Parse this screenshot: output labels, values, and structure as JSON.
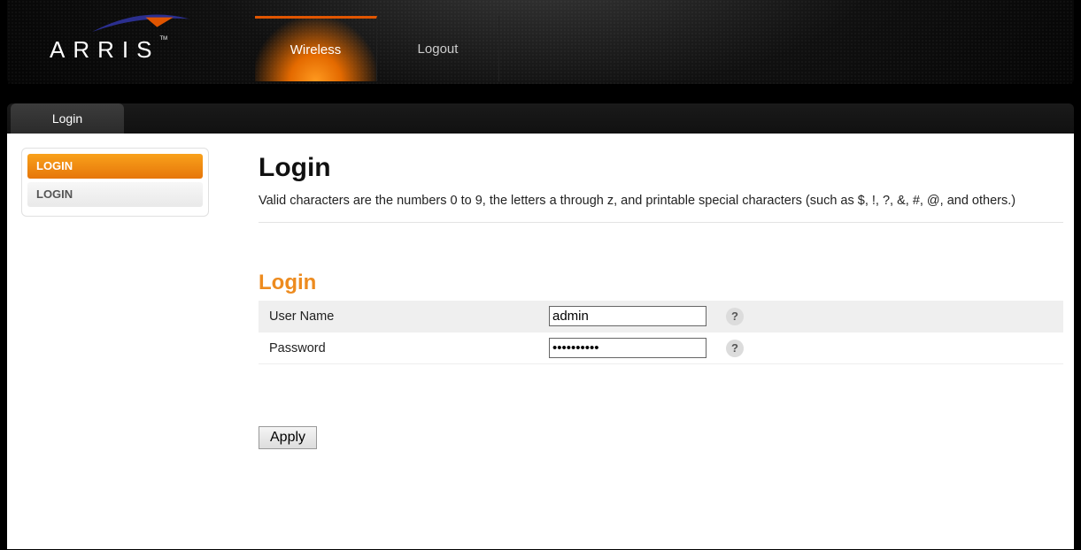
{
  "brand": {
    "name": "ARRIS",
    "tm": "TM"
  },
  "nav": {
    "wireless": "Wireless",
    "logout": "Logout"
  },
  "subnav": {
    "login": "Login"
  },
  "sidebar": {
    "items": [
      {
        "label": "LOGIN"
      },
      {
        "label": "LOGIN"
      }
    ]
  },
  "page": {
    "title": "Login",
    "description": "Valid characters are the numbers 0 to 9, the letters a through z, and printable special characters (such as $, !, ?, &, #, @, and others.)",
    "section_title": "Login"
  },
  "form": {
    "username_label": "User Name",
    "username_value": "admin",
    "password_label": "Password",
    "password_value": "••••••••••",
    "help_glyph": "?",
    "apply_label": "Apply"
  }
}
